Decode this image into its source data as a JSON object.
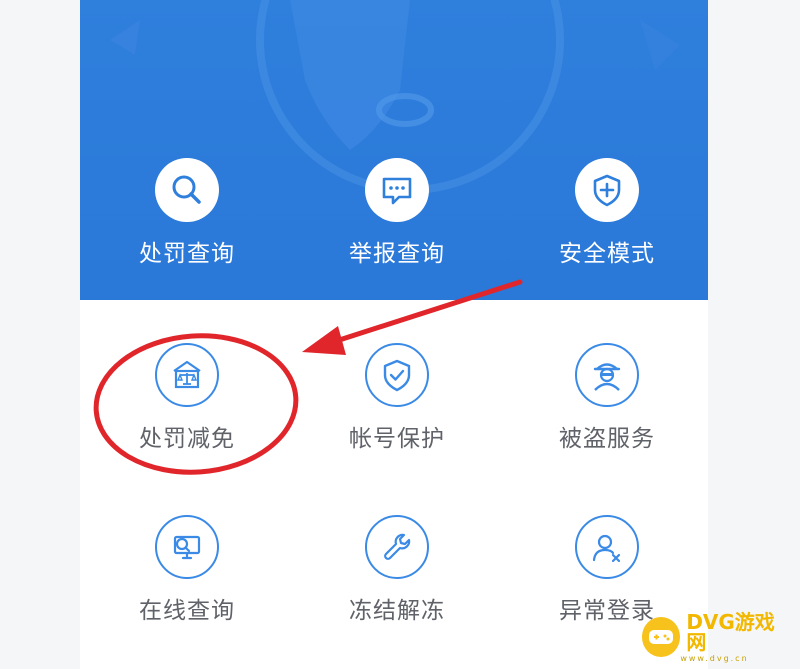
{
  "colors": {
    "brand_blue": "#2f7fdd",
    "icon_blue": "#3a8ae6",
    "label_gray": "#5f6268",
    "annotation_red": "#e0262b",
    "watermark_yellow": "#f6c21b"
  },
  "hero_services": [
    {
      "label": "处罚查询",
      "icon": "magnifier-icon"
    },
    {
      "label": "举报查询",
      "icon": "chat-bubble-icon"
    },
    {
      "label": "安全模式",
      "icon": "shield-plus-icon"
    }
  ],
  "services_row1": [
    {
      "label": "处罚减免",
      "icon": "scales-icon"
    },
    {
      "label": "帐号保护",
      "icon": "shield-check-icon"
    },
    {
      "label": "被盗服务",
      "icon": "thief-icon"
    }
  ],
  "services_row2": [
    {
      "label": "在线查询",
      "icon": "monitor-search-icon"
    },
    {
      "label": "冻结解冻",
      "icon": "wrench-icon"
    },
    {
      "label": "异常登录",
      "icon": "user-x-icon"
    }
  ],
  "watermark": {
    "name": "DVG游戏网",
    "sub": "www.dvg.cn"
  }
}
